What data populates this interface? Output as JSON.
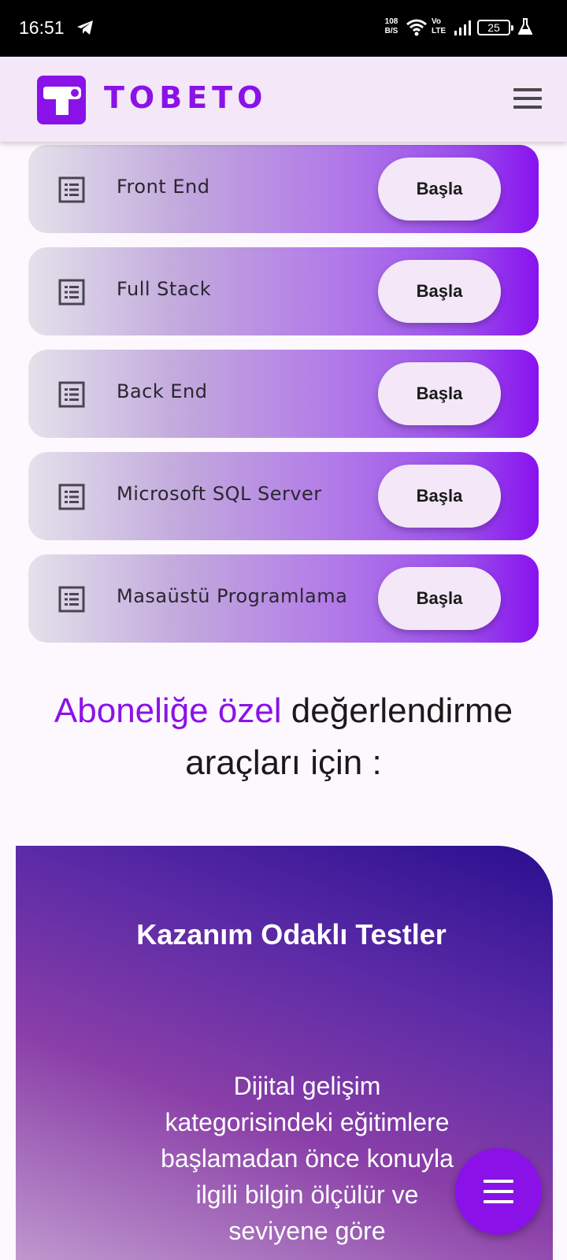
{
  "status_bar": {
    "time": "16:51",
    "net_speed_value": "108",
    "net_speed_unit": "B/S",
    "volte_top": "Vo",
    "volte_bottom": "LTE",
    "battery": "25"
  },
  "app_bar": {
    "logo_text": "TOBETO",
    "brand_color": "#8a12e8"
  },
  "courses": [
    {
      "label": "Front End",
      "button": "Başla"
    },
    {
      "label": "Full Stack",
      "button": "Başla"
    },
    {
      "label": "Back End",
      "button": "Başla"
    },
    {
      "label": "Microsoft SQL Server",
      "button": "Başla"
    },
    {
      "label": "Masaüstü Programlama",
      "button": "Başla"
    }
  ],
  "heading": {
    "accent": "Aboneliğe özel",
    "rest_line1": " değerlendirme",
    "line2": "araçları için :"
  },
  "test_card": {
    "title": "Kazanım Odaklı Testler",
    "description": "Dijital gelişim kategorisindeki eğitimlere başlamadan önce konuyla ilgili bilgin ölçülür ve seviyene göre"
  },
  "icons": {
    "course": "list-alt-icon",
    "menu": "hamburger-menu-icon",
    "fab": "hamburger-menu-icon"
  }
}
